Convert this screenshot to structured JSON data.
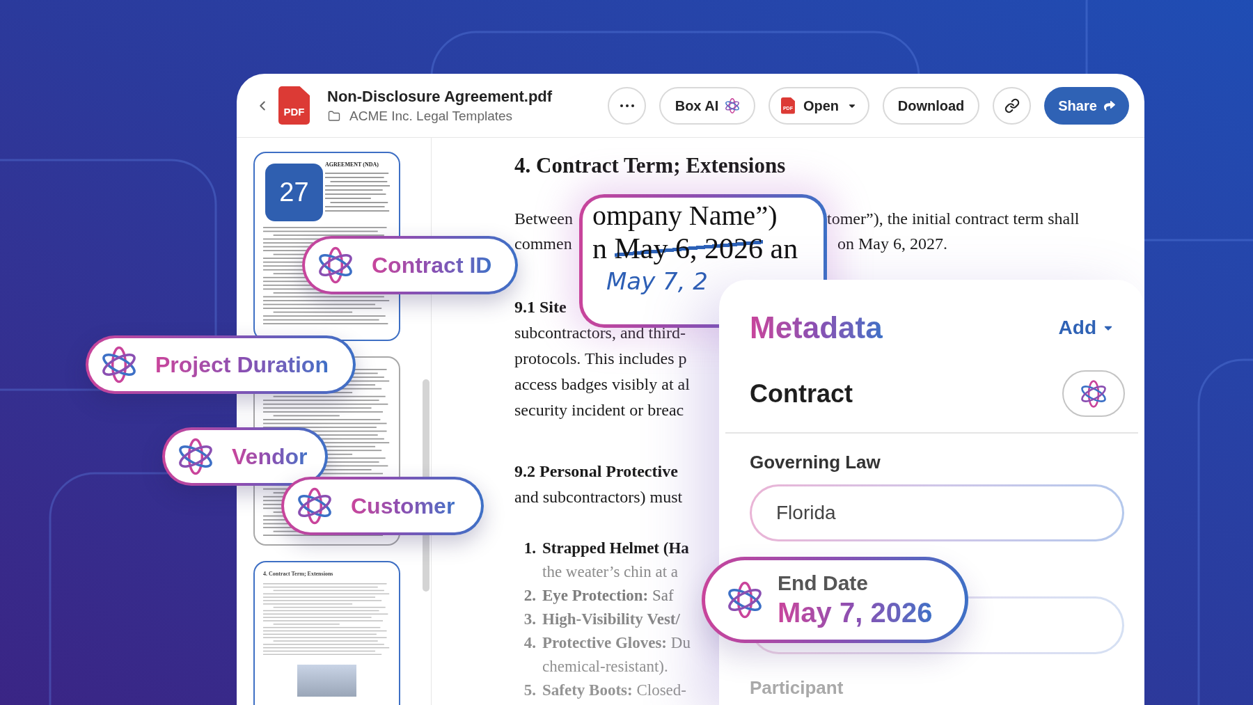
{
  "header": {
    "file_icon_label": "PDF",
    "file_name": "Non-Disclosure Agreement.pdf",
    "folder": "ACME Inc. Legal Templates",
    "buttons": [
      {
        "kind": "more"
      },
      {
        "kind": "ai",
        "label": "Box AI"
      },
      {
        "kind": "open",
        "label": "Open",
        "icon_label": "PDF"
      },
      {
        "kind": "download",
        "label": "Download"
      },
      {
        "kind": "link"
      },
      {
        "kind": "share",
        "label": "Share"
      }
    ]
  },
  "thumbnails": {
    "pages": [
      {
        "kind": "cover",
        "selected": true,
        "badge": "27",
        "heading": "AGREEMENT (NDA)"
      },
      {
        "kind": "text",
        "selected": false
      },
      {
        "kind": "section",
        "selected": true,
        "heading": "4. Contract Term; Extensions"
      }
    ]
  },
  "document": {
    "heading": "4. Contract Term; Extensions",
    "intro_lines": [
      {
        "left": "Between",
        "right": "tomer”), the initial contract term shall"
      },
      {
        "left": "commen",
        "right": "on May 6, 2027."
      }
    ],
    "magnifier": {
      "line_1": "ompany Name”)",
      "line_2": {
        "before": "n",
        "struck": "May 6, 2026",
        "after": "an"
      },
      "handwriting": "May 7, 2"
    },
    "sections": [
      {
        "title": "9.1 Site",
        "lines": [
          "subcontractors, and third-",
          "protocols. This includes p",
          "access badges visibly at al",
          "security incident or breac"
        ]
      },
      {
        "title": "9.2 Personal Protective",
        "lines": [
          "and subcontractors) must"
        ]
      }
    ],
    "list": [
      {
        "number": "1.",
        "title": "Strapped Helmet (Ha",
        "continuation": "the weater’s chin at a"
      },
      {
        "number": "2.",
        "title": "Eye Protection:",
        "text": "Saf"
      },
      {
        "number": "3.",
        "title": "High-Visibility Vest/"
      },
      {
        "number": "4.",
        "title": "Protective Gloves:",
        "text": "Du",
        "continuation": "chemical-resistant)."
      },
      {
        "number": "5.",
        "title": "Safety Boots:",
        "text": "Closed-"
      }
    ]
  },
  "metadata": {
    "title": "Metadata",
    "add_label": "Add",
    "template": "Contract",
    "fields": [
      {
        "kind": "filled",
        "label": "Governing Law",
        "value": "Florida"
      },
      {
        "kind": "covered"
      },
      {
        "kind": "label_only",
        "label": "Participant"
      }
    ],
    "floating_field": {
      "label": "End Date",
      "value": "May 7, 2026"
    }
  },
  "tags": [
    {
      "label": "Contract ID"
    },
    {
      "label": "Project Duration"
    },
    {
      "label": "Vendor"
    },
    {
      "label": "Customer"
    }
  ]
}
